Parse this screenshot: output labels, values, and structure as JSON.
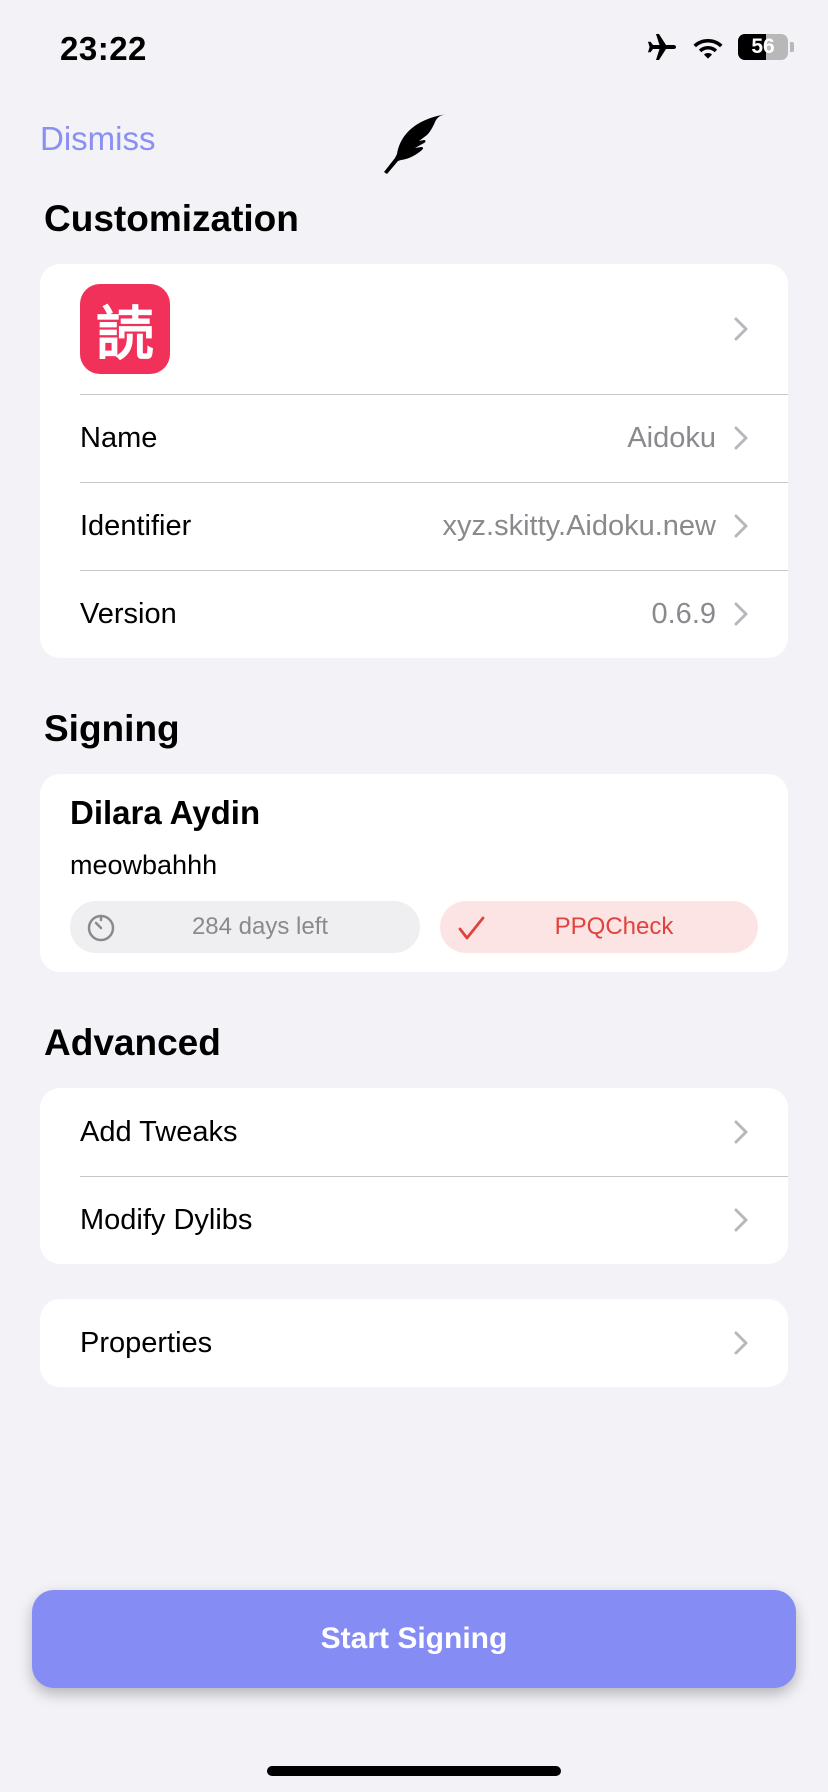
{
  "status_bar": {
    "time": "23:22",
    "battery_level": "56",
    "battery_fraction": 0.56,
    "icons": [
      "airplane-icon",
      "wifi-icon",
      "battery-icon"
    ]
  },
  "nav": {
    "dismiss_label": "Dismiss",
    "center_icon": "feather-icon",
    "accent_color": "#8a8ff2"
  },
  "customization": {
    "title": "Customization",
    "app_icon_glyph": "読",
    "app_icon_color": "#f2315a",
    "rows": [
      {
        "label": "Name",
        "value": "Aidoku"
      },
      {
        "label": "Identifier",
        "value": "xyz.skitty.Aidoku.new"
      },
      {
        "label": "Version",
        "value": "0.6.9"
      }
    ]
  },
  "signing": {
    "title": "Signing",
    "name": "Dilara Aydin",
    "subtitle": "meowbahhh",
    "days_left": "284 days left",
    "cert_label": "PPQCheck"
  },
  "advanced": {
    "title": "Advanced",
    "rows": [
      {
        "label": "Add Tweaks"
      },
      {
        "label": "Modify Dylibs"
      }
    ],
    "properties_label": "Properties"
  },
  "footer": {
    "start_label": "Start Signing",
    "button_color": "#858cf4"
  }
}
